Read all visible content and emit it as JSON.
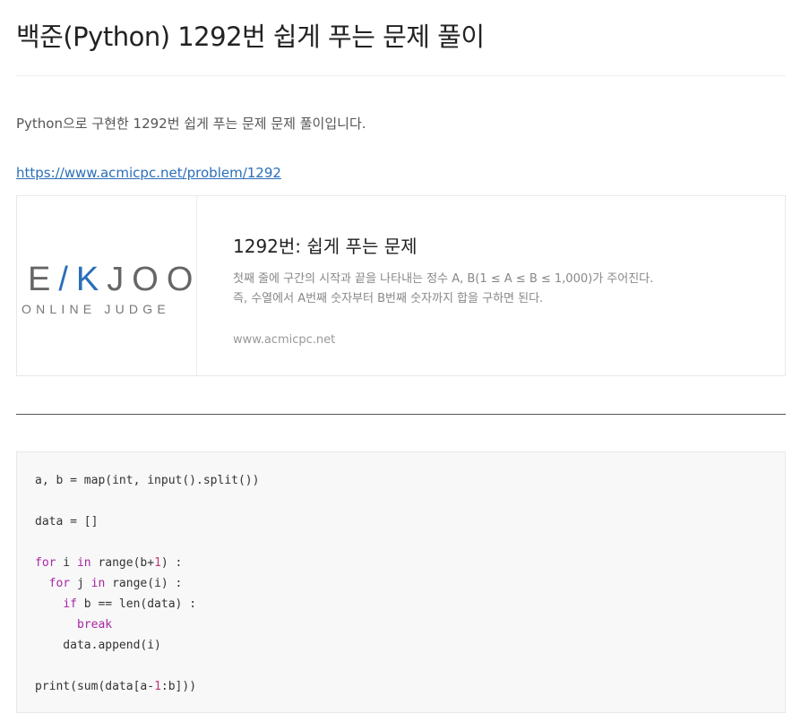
{
  "post": {
    "title": "백준(Python) 1292번 쉽게 푸는 문제 풀이",
    "intro": "Python으로 구현한 1292번 쉽게 푸는 문제 문제 풀이입니다.",
    "link_text": "https://www.acmicpc.net/problem/1292"
  },
  "og_card": {
    "logo_main": [
      "E",
      "/K",
      "JOO"
    ],
    "logo_sub": "ONLINE JUDGE",
    "title": "1292번: 쉽게 푸는 문제",
    "description": "첫째 줄에 구간의 시작과 끝을 나타내는 정수 A, B(1 ≤ A ≤ B ≤ 1,000)가 주어진다. 즉, 수열에서 A번째 숫자부터 B번째 숫자까지 합을 구하면 된다.",
    "host": "www.acmicpc.net"
  },
  "code": {
    "lines": [
      [
        {
          "t": "a, b = map(int, input().split())"
        }
      ],
      [
        {
          "t": ""
        }
      ],
      [
        {
          "t": "data = []"
        }
      ],
      [
        {
          "t": ""
        }
      ],
      [
        {
          "t": "for",
          "c": "kw"
        },
        {
          "t": " i "
        },
        {
          "t": "in",
          "c": "kw"
        },
        {
          "t": " range(b+"
        },
        {
          "t": "1",
          "c": "num"
        },
        {
          "t": ") :"
        }
      ],
      [
        {
          "t": "  "
        },
        {
          "t": "for",
          "c": "kw"
        },
        {
          "t": " j "
        },
        {
          "t": "in",
          "c": "kw"
        },
        {
          "t": " range(i) :"
        }
      ],
      [
        {
          "t": "    "
        },
        {
          "t": "if",
          "c": "kw"
        },
        {
          "t": " b == len(data) :"
        }
      ],
      [
        {
          "t": "      "
        },
        {
          "t": "break",
          "c": "kw"
        }
      ],
      [
        {
          "t": "    data.append(i)"
        }
      ],
      [
        {
          "t": ""
        }
      ],
      [
        {
          "t": "print(sum(data[a-"
        },
        {
          "t": "1",
          "c": "num"
        },
        {
          "t": ":b]))"
        }
      ]
    ]
  }
}
